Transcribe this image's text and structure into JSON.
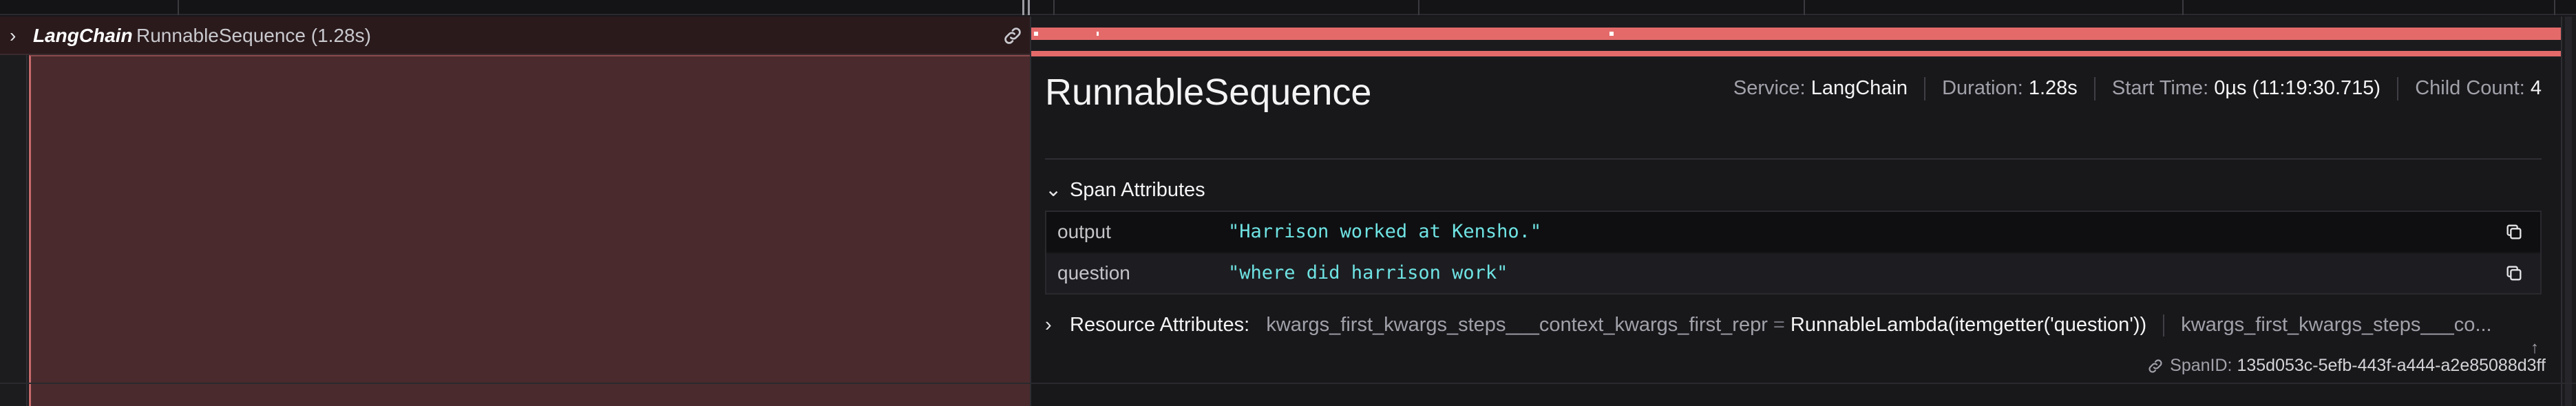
{
  "trace_row": {
    "provider": "LangChain",
    "span_title": "RunnableSequence (1.28s)"
  },
  "details": {
    "title": "RunnableSequence",
    "service_label": "Service:",
    "service_value": "LangChain",
    "duration_label": "Duration:",
    "duration_value": "1.28s",
    "start_label": "Start Time:",
    "start_value": "0µs (11:19:30.715)",
    "child_label": "Child Count:",
    "child_value": "4"
  },
  "span_attributes": {
    "header": "Span Attributes",
    "rows": [
      {
        "key": "output",
        "value": "\"Harrison worked at Kensho.\""
      },
      {
        "key": "question",
        "value": "\"where did harrison work\""
      }
    ]
  },
  "resource_attributes": {
    "header": "Resource Attributes:",
    "key1": "kwargs_first_kwargs_steps___context_kwargs_first_repr",
    "eq": "=",
    "val1": "RunnableLambda(itemgetter('question'))",
    "key2": "kwargs_first_kwargs_steps___co..."
  },
  "span_id": {
    "label": "SpanID:",
    "value": "135d053c-5efb-443f-a444-a2e85088d3ff"
  },
  "colors": {
    "span_bar": "#e46a6a",
    "span_fill": "#4a2a2d",
    "attribute_value": "#6fe3e3"
  },
  "icons": [
    "chevron-right-icon",
    "link-icon",
    "chevron-down-icon",
    "copy-icon",
    "arrow-up-icon"
  ]
}
